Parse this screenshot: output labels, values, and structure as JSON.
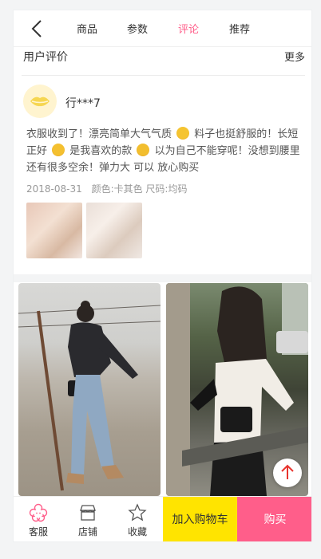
{
  "nav": {
    "tabs": [
      {
        "label": "商品"
      },
      {
        "label": "参数"
      },
      {
        "label": "评论"
      },
      {
        "label": "推荐"
      }
    ],
    "active_tab": "评论"
  },
  "review": {
    "section_title": "用户评价",
    "more_label": "更多",
    "user": {
      "name": "行***7"
    },
    "content": {
      "p1": "衣服收到了！漂亮简单大气气质",
      "p2": "料子也挺舒服的！长短正好",
      "p3": "是我喜欢的款",
      "p4": "以为自己不能穿呢！没想到腰里还有很多空余！弹力大 可以 放心购买"
    },
    "date": "2018-08-31",
    "spec": "颜色:卡其色 尺码:均码"
  },
  "bottom_bar": {
    "service_label": "客服",
    "shop_label": "店铺",
    "favorite_label": "收藏",
    "cart_label": "加入购物车",
    "buy_label": "购买"
  },
  "colors": {
    "accent_pink": "#ff5e8a",
    "accent_yellow": "#ffe400",
    "scroll_top_arrow": "#e8342e"
  },
  "icons": {
    "back": "chevron-left-icon",
    "service": "flower-service-icon",
    "shop": "shop-icon",
    "favorite": "star-icon",
    "scroll_top": "arrow-up-icon"
  }
}
